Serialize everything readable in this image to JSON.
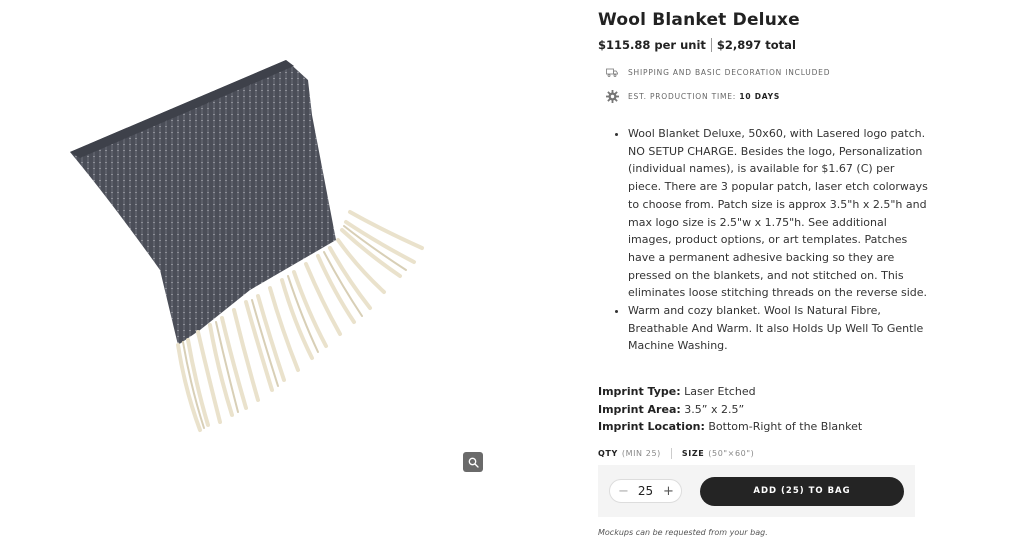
{
  "product": {
    "title": "Wool Blanket Deluxe",
    "price_unit": "$115.88 per unit",
    "price_total": "$2,897 total",
    "zoom_icon": "magnifier-icon"
  },
  "shipping": {
    "icon": "truck-icon",
    "text": "SHIPPING AND BASIC DECORATION INCLUDED"
  },
  "production": {
    "icon": "gear-icon",
    "label": "EST. PRODUCTION TIME:",
    "value": "10 DAYS"
  },
  "description": {
    "bullets": [
      "Wool Blanket Deluxe, 50x60, with Lasered logo patch. NO SETUP CHARGE. Besides the logo, Personalization (individual names), is available for $1.67 (C) per piece. There are 3 popular patch, laser etch colorways to choose from. Patch size is approx 3.5\"h x 2.5\"h and max logo size is 2.5\"w x 1.75\"h. See additional images, product options, or art templates. Patches have a permanent adhesive backing so they are pressed on the blankets, and not stitched on. This eliminates loose stitching threads on the reverse side.",
      "Warm and cozy blanket. Wool Is Natural Fibre, Breathable And Warm. It also Holds Up Well To Gentle Machine Washing."
    ]
  },
  "imprint": {
    "type_label": "Imprint Type:",
    "type_value": "Laser Etched",
    "area_label": "Imprint Area:",
    "area_value": "3.5” x 2.5”",
    "location_label": "Imprint Location:",
    "location_value": "Bottom-Right of the Blanket"
  },
  "options": {
    "qty_label": "QTY",
    "qty_note": "(MIN 25)",
    "size_label": "SIZE",
    "size_value": "(50\"×60\")"
  },
  "cart": {
    "quantity": "25",
    "minus": "−",
    "plus": "+",
    "add_label": "ADD (25) TO BAG",
    "note": "Mockups can be requested from your bag."
  },
  "colors": {
    "blanket": "#4a4d57",
    "fringe": "#ece4cf",
    "button": "#242424"
  }
}
